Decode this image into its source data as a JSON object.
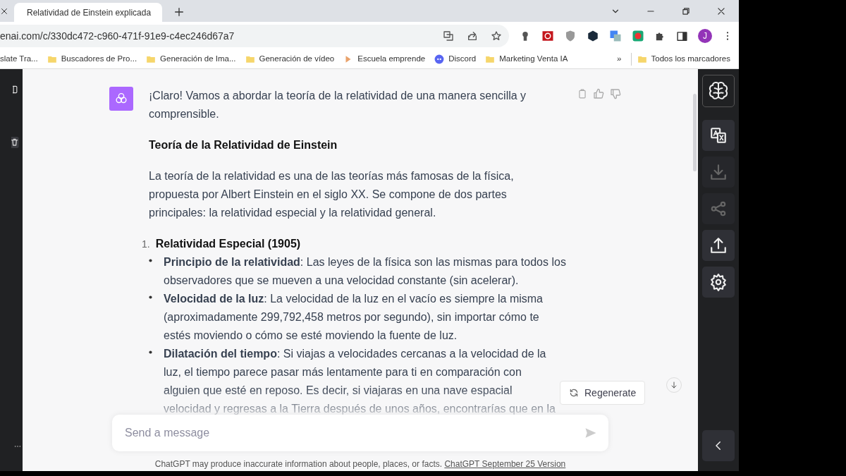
{
  "browser": {
    "tabs": [
      {
        "title": "Relatividad de Einstein explicada",
        "selected": true
      }
    ],
    "address": "enai.com/c/330dc472-c960-471f-91e9-c4ec246d67a7",
    "profile": "J",
    "bookmarks": [
      {
        "label": "slate Tra...",
        "kind": "site"
      },
      {
        "label": "Buscadores de Pro...",
        "kind": "folder"
      },
      {
        "label": "Generación de Ima...",
        "kind": "folder"
      },
      {
        "label": "Generación de vídeo",
        "kind": "folder"
      },
      {
        "label": "Escuela emprende",
        "kind": "site"
      },
      {
        "label": "Discord",
        "kind": "discord"
      },
      {
        "label": "Marketing Venta IA",
        "kind": "folder"
      }
    ],
    "more_bookmarks": "»",
    "all_bookmarks": "Todos los marcadores"
  },
  "message": {
    "intro": [
      "¡Claro! Vamos a abordar la teoría de la relatividad de una manera sencilla y",
      "comprensible."
    ],
    "heading": "Teoría de la Relatividad de Einstein",
    "paragraph": [
      "La teoría de la relatividad es una de las teorías más famosas de la física,",
      "propuesta por Albert Einstein en el siglo XX. Se compone de dos partes",
      "principales: la relatividad especial y la relatividad general."
    ],
    "list": [
      {
        "number": "1.",
        "title": "Relatividad Especial (1905)",
        "bullets": [
          {
            "lines": [
              "**Principio de la relatividad**: Las leyes de la física son las mismas para todos los",
              "observadores que se mueven a una velocidad constante (sin acelerar)."
            ]
          },
          {
            "lines": [
              "**Velocidad de la luz**: La velocidad de la luz en el vacío es siempre la misma",
              "(aproximadamente 299,792,458 metros por segundo), sin importar cómo te",
              "estés moviendo o cómo se esté moviendo la fuente de luz."
            ]
          },
          {
            "lines": [
              "**Dilatación del tiempo**: Si viajas a velocidades cercanas a la velocidad de la",
              "luz, el tiempo parece pasar más lentamente para ti en comparación con",
              "alguien que esté en reposo. Es decir, si viajaras en una nave espacial",
              "velocidad y regresas a la Tierra después de unos años, encontrarías que en la"
            ]
          }
        ]
      }
    ]
  },
  "regenerate": "Regenerate",
  "input": {
    "placeholder": "Send a message"
  },
  "footer": {
    "text": "ChatGPT may produce inaccurate information about people, places, or facts.",
    "link": "ChatGPT September 25 Version"
  },
  "tools": [
    {
      "kind": "translate",
      "disabled": false
    },
    {
      "kind": "download",
      "disabled": true
    },
    {
      "kind": "share",
      "disabled": true
    },
    {
      "kind": "upload",
      "disabled": false
    },
    {
      "kind": "settings",
      "disabled": false
    }
  ]
}
